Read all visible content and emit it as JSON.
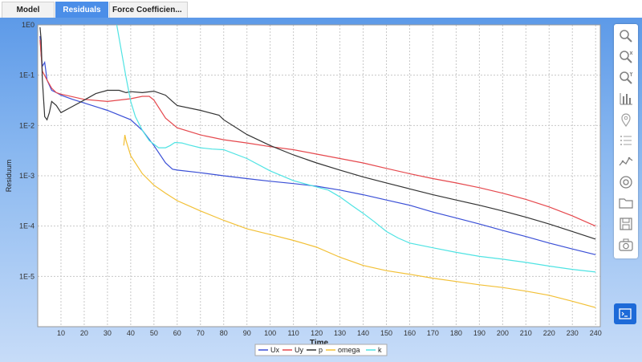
{
  "tabs": [
    {
      "label": "Model",
      "active": false
    },
    {
      "label": "Residuals",
      "active": true
    },
    {
      "label": "Force Coefficien...",
      "active": false
    }
  ],
  "toolbar": {
    "icons": [
      "zoom-icon",
      "zoom-x-icon",
      "zoom-y-icon",
      "bar-chart-icon",
      "location-pin-icon",
      "list-icon",
      "line-chart-icon",
      "settings-ring-icon",
      "folder-icon",
      "save-icon",
      "camera-icon"
    ],
    "console_icon": "console-icon"
  },
  "colors": {
    "Ux": "#3a4fd6",
    "Uy": "#e5484d",
    "p": "#333333",
    "omega": "#f2c036",
    "k": "#4fe3e3"
  },
  "chart_data": {
    "type": "line",
    "xlabel": "Time",
    "ylabel": "Residuum",
    "yscale": "log",
    "xlim": [
      0,
      242
    ],
    "ylim": [
      1e-06,
      1
    ],
    "xticks": [
      10,
      20,
      30,
      40,
      50,
      60,
      70,
      80,
      90,
      100,
      110,
      120,
      130,
      140,
      150,
      160,
      170,
      180,
      190,
      200,
      210,
      220,
      230,
      240
    ],
    "yticks": [
      {
        "value": 1,
        "label": "1E0"
      },
      {
        "value": 0.1,
        "label": "1E-1"
      },
      {
        "value": 0.01,
        "label": "1E-2"
      },
      {
        "value": 0.001,
        "label": "1E-3"
      },
      {
        "value": 0.0001,
        "label": "1E-4"
      },
      {
        "value": 1e-05,
        "label": "1E-5"
      }
    ],
    "grid": true,
    "legend_position": "bottom",
    "series": [
      {
        "name": "Ux",
        "x": [
          1,
          1.5,
          2,
          3,
          4,
          6,
          8,
          10,
          15,
          20,
          30,
          40,
          45,
          50,
          55,
          58,
          60,
          70,
          80,
          90,
          100,
          110,
          120,
          130,
          140,
          150,
          160,
          170,
          180,
          190,
          200,
          210,
          220,
          230,
          240
        ],
        "y": [
          0.6,
          0.25,
          0.15,
          0.18,
          0.08,
          0.05,
          0.045,
          0.04,
          0.033,
          0.028,
          0.02,
          0.013,
          0.008,
          0.004,
          0.0018,
          0.00135,
          0.0013,
          0.00115,
          0.001,
          0.00088,
          0.00078,
          0.0007,
          0.00062,
          0.00052,
          0.00042,
          0.00033,
          0.00026,
          0.00019,
          0.000145,
          0.00011,
          8.2e-05,
          6.2e-05,
          4.6e-05,
          3.5e-05,
          2.7e-05
        ]
      },
      {
        "name": "Uy",
        "x": [
          1,
          2,
          4,
          6,
          8,
          10,
          20,
          30,
          40,
          45,
          48,
          50,
          55,
          60,
          70,
          80,
          90,
          100,
          110,
          120,
          130,
          140,
          150,
          160,
          170,
          180,
          190,
          200,
          210,
          220,
          230,
          240
        ],
        "y": [
          0.5,
          0.12,
          0.08,
          0.055,
          0.045,
          0.042,
          0.033,
          0.03,
          0.034,
          0.038,
          0.038,
          0.032,
          0.014,
          0.009,
          0.0065,
          0.0052,
          0.0045,
          0.0038,
          0.0033,
          0.0027,
          0.0022,
          0.0018,
          0.0014,
          0.0011,
          0.00088,
          0.00072,
          0.00058,
          0.00045,
          0.00034,
          0.00024,
          0.00016,
          0.0001
        ]
      },
      {
        "name": "p",
        "x": [
          1,
          1.5,
          2,
          3,
          4,
          5,
          6,
          8,
          10,
          15,
          20,
          25,
          30,
          35,
          38,
          40,
          45,
          50,
          55,
          58,
          60,
          70,
          78,
          80,
          90,
          100,
          110,
          120,
          130,
          140,
          150,
          160,
          170,
          180,
          190,
          200,
          210,
          220,
          230,
          240
        ],
        "y": [
          0.9,
          0.5,
          0.08,
          0.015,
          0.013,
          0.018,
          0.03,
          0.025,
          0.018,
          0.024,
          0.032,
          0.043,
          0.05,
          0.05,
          0.045,
          0.047,
          0.045,
          0.048,
          0.04,
          0.03,
          0.025,
          0.02,
          0.016,
          0.013,
          0.0066,
          0.004,
          0.0026,
          0.0018,
          0.0013,
          0.00095,
          0.00072,
          0.00055,
          0.00042,
          0.00033,
          0.00026,
          0.0002,
          0.00015,
          0.00011,
          7.8e-05,
          5.5e-05
        ]
      },
      {
        "name": "omega",
        "x": [
          37,
          37.5,
          38,
          40,
          45,
          50,
          55,
          60,
          70,
          80,
          90,
          100,
          110,
          120,
          130,
          140,
          150,
          160,
          170,
          180,
          190,
          200,
          210,
          220,
          230,
          240
        ],
        "y": [
          0.004,
          0.0065,
          0.005,
          0.0025,
          0.0011,
          0.00065,
          0.00045,
          0.00032,
          0.0002,
          0.00013,
          8.8e-05,
          6.8e-05,
          5.2e-05,
          3.8e-05,
          2.4e-05,
          1.65e-05,
          1.3e-05,
          1.1e-05,
          9.2e-06,
          7.9e-06,
          6.8e-06,
          6e-06,
          5.1e-06,
          4.2e-06,
          3.2e-06,
          2.4e-06
        ]
      },
      {
        "name": "k",
        "x": [
          34,
          36,
          38,
          40,
          42,
          45,
          48,
          52,
          55,
          57,
          59,
          62,
          65,
          70,
          75,
          80,
          90,
          100,
          110,
          120,
          125,
          130,
          135,
          140,
          145,
          150,
          155,
          160,
          170,
          180,
          190,
          200,
          210,
          220,
          230,
          240
        ],
        "y": [
          1.0,
          0.3,
          0.09,
          0.03,
          0.015,
          0.008,
          0.005,
          0.0036,
          0.0036,
          0.004,
          0.0046,
          0.0045,
          0.0041,
          0.0036,
          0.0034,
          0.0033,
          0.0022,
          0.00125,
          0.0008,
          0.0006,
          0.00052,
          0.00038,
          0.00026,
          0.00018,
          0.00012,
          7.8e-05,
          5.8e-05,
          4.6e-05,
          3.7e-05,
          3e-05,
          2.5e-05,
          2.2e-05,
          1.9e-05,
          1.6e-05,
          1.38e-05,
          1.22e-05
        ]
      }
    ]
  }
}
